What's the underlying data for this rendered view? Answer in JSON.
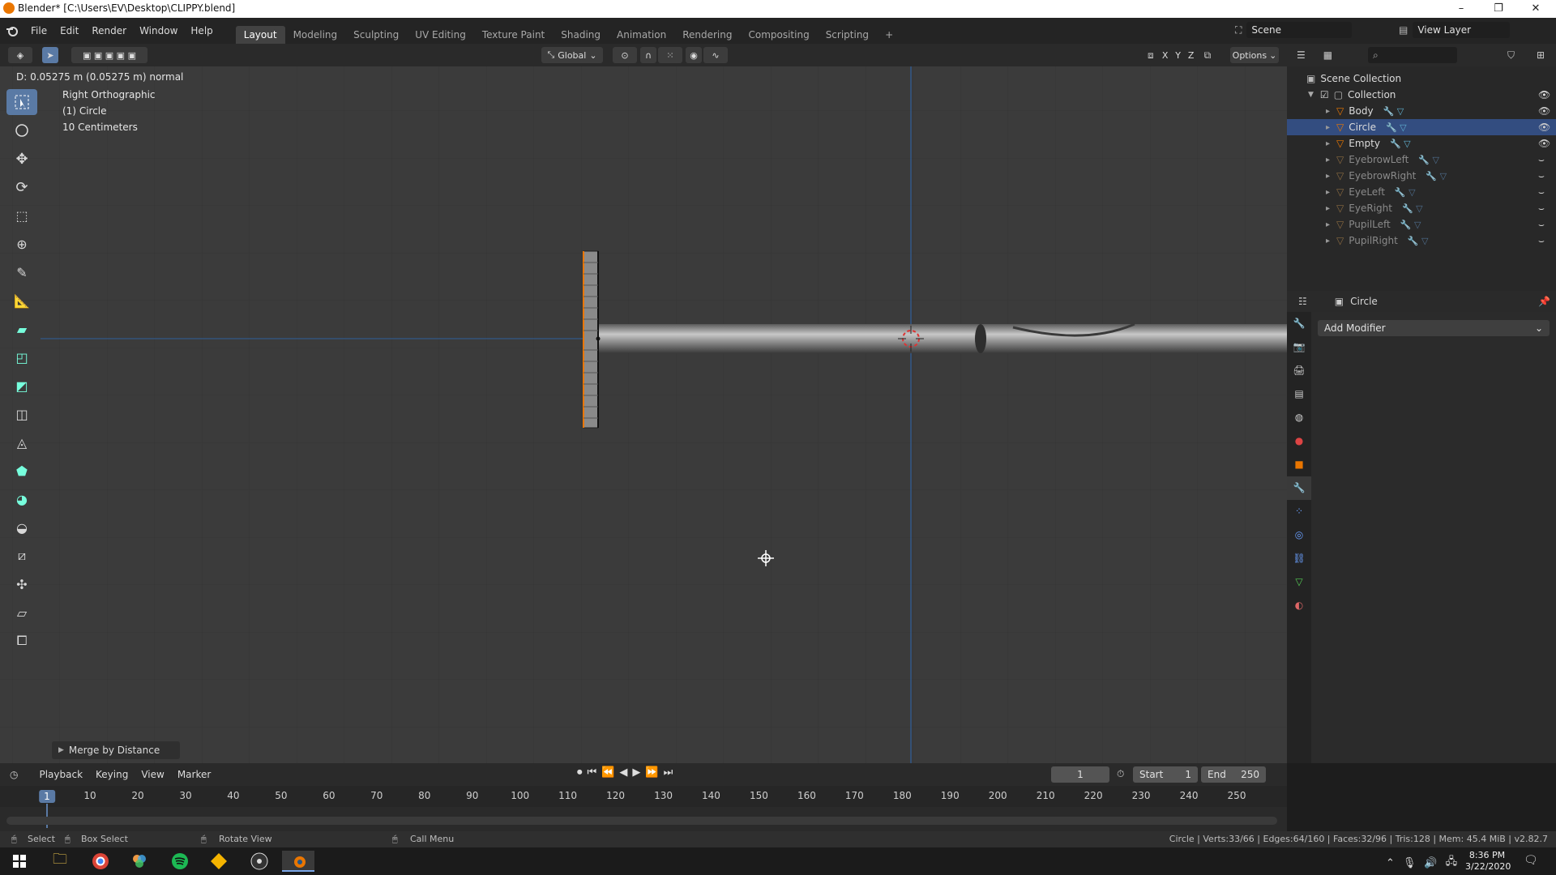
{
  "window": {
    "title": "Blender* [C:\\Users\\EV\\Desktop\\CLIPPY.blend]",
    "minimize": "–",
    "restore": "❐",
    "close": "✕"
  },
  "menus": [
    "File",
    "Edit",
    "Render",
    "Window",
    "Help"
  ],
  "workspaces": [
    "Layout",
    "Modeling",
    "Sculpting",
    "UV Editing",
    "Texture Paint",
    "Shading",
    "Animation",
    "Rendering",
    "Compositing",
    "Scripting"
  ],
  "add_workspace": "+",
  "scene": {
    "name": "Scene",
    "view_layer": "View Layer"
  },
  "viewport_header": {
    "orientation": "Global",
    "options": "Options",
    "axes": [
      "X",
      "Y",
      "Z"
    ]
  },
  "operator_info": "D: 0.05275 m (0.05275 m) normal",
  "viewport_overlay": {
    "view": "Right Orthographic",
    "object": "(1) Circle",
    "scale": "10 Centimeters"
  },
  "last_operator": "Merge by Distance",
  "outliner": {
    "root": "Scene Collection",
    "collection": "Collection",
    "items": [
      {
        "name": "Body",
        "selected": false,
        "dim": false
      },
      {
        "name": "Circle",
        "selected": true,
        "dim": false
      },
      {
        "name": "Empty",
        "selected": false,
        "dim": false
      },
      {
        "name": "EyebrowLeft",
        "selected": false,
        "dim": true
      },
      {
        "name": "EyebrowRight",
        "selected": false,
        "dim": true
      },
      {
        "name": "EyeLeft",
        "selected": false,
        "dim": true
      },
      {
        "name": "EyeRight",
        "selected": false,
        "dim": true
      },
      {
        "name": "PupilLeft",
        "selected": false,
        "dim": true
      },
      {
        "name": "PupilRight",
        "selected": false,
        "dim": true
      }
    ]
  },
  "properties": {
    "object_name": "Circle",
    "add_modifier": "Add Modifier"
  },
  "timeline": {
    "menus": [
      "Playback",
      "Keying",
      "View",
      "Marker"
    ],
    "current_frame": "1",
    "start_label": "Start",
    "start": "1",
    "end_label": "End",
    "end": "250",
    "frame_labels": [
      "1",
      "10",
      "20",
      "30",
      "40",
      "50",
      "60",
      "70",
      "80",
      "90",
      "100",
      "110",
      "120",
      "130",
      "140",
      "150",
      "160",
      "170",
      "180",
      "190",
      "200",
      "210",
      "220",
      "230",
      "240",
      "250"
    ]
  },
  "statusbar": {
    "select": "Select",
    "box_select": "Box Select",
    "rotate_view": "Rotate View",
    "call_menu": "Call Menu",
    "stats": "Circle | Verts:33/66 | Edges:64/160 | Faces:32/96 | Tris:128 | Mem: 45.4 MiB | v2.82.7"
  },
  "taskbar": {
    "time": "8:36 PM",
    "date": "3/22/2020"
  },
  "colors": {
    "accent": "#5a7aa5",
    "selection": "#334d80",
    "orange": "#ea7600",
    "axis_blue": "#2f5f9b"
  }
}
